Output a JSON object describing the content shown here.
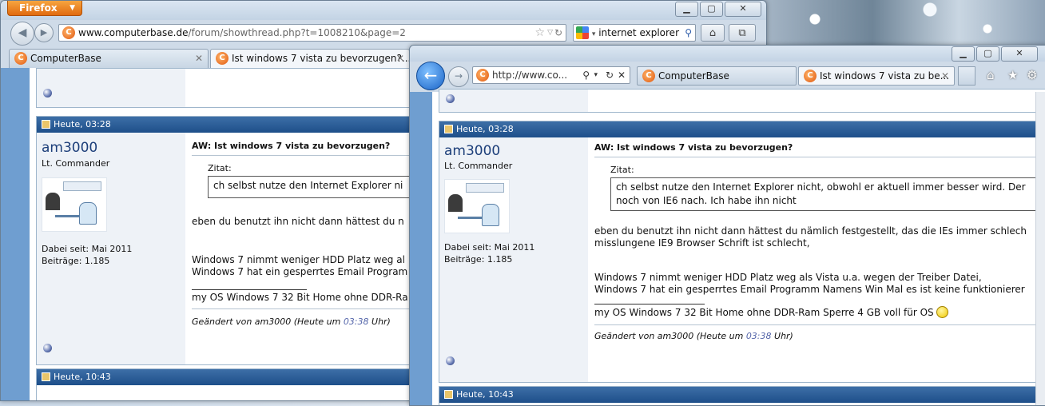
{
  "firefox": {
    "menu_button": "Firefox",
    "url_host": "www.computerbase.de",
    "url_path": "/forum/showthread.php?t=1008210&page=2",
    "search_text": "internet explorer",
    "tabs": [
      {
        "label": "ComputerBase"
      },
      {
        "label": "Ist windows 7 vista zu bevorzugen?..."
      }
    ],
    "post1": {
      "header": "Heute, 03:28",
      "username": "am3000",
      "rank": "Lt. Commander",
      "joined": "Dabei seit: Mai 2011",
      "posts": "Beiträge: 1.185",
      "title": "AW: Ist windows 7 vista zu bevorzugen?",
      "quote_label": "Zitat:",
      "quote_text": "ch selbst nutze den Internet Explorer ni",
      "line1": "eben du benutzt ihn nicht dann hättest du n",
      "line2": "Windows 7 nimmt weniger HDD Platz weg al",
      "line3": "Windows 7 hat ein gesperrtes Email Program",
      "signature": "my OS Windows 7 32 Bit Home ohne DDR-Ra",
      "edited_prefix": "Geändert von am3000 (Heute um ",
      "edited_time": "03:38",
      "edited_suffix": " Uhr)"
    },
    "post2": {
      "header": "Heute, 10:43"
    }
  },
  "ie": {
    "url_text": "http://www.co...",
    "tabs": [
      {
        "label": "ComputerBase"
      },
      {
        "label": "Ist windows 7 vista zu be..."
      }
    ],
    "post1": {
      "header": "Heute, 03:28",
      "username": "am3000",
      "rank": "Lt. Commander",
      "joined": "Dabei seit: Mai 2011",
      "posts": "Beiträge: 1.185",
      "title": "AW: Ist windows 7 vista zu bevorzugen?",
      "quote_label": "Zitat:",
      "quote_line1": "ch selbst nutze den Internet Explorer nicht, obwohl er aktuell immer besser wird. Der",
      "quote_line2": "noch von IE6 nach. Ich habe ihn nicht",
      "line1": "eben du benutzt ihn nicht dann hättest du nämlich festgestellt, das die IEs immer schlech",
      "line2": "misslungene IE9 Browser Schrift ist schlecht,",
      "line3": "Windows 7 nimmt weniger HDD Platz weg als Vista u.a. wegen der Treiber Datei,",
      "line4": "Windows 7 hat ein gesperrtes Email Programm Namens Win Mal es ist keine funktionierer",
      "signature": "my OS Windows 7 32 Bit Home ohne DDR-Ram Sperre 4 GB voll für OS",
      "edited_prefix": "Geändert von am3000 (Heute um ",
      "edited_time": "03:38",
      "edited_suffix": " Uhr)"
    },
    "post2": {
      "header": "Heute, 10:43"
    }
  },
  "icons": [
    "back-icon",
    "forward-icon",
    "bookmark-star-icon",
    "reload-icon",
    "google-icon",
    "search-icon",
    "home-icon",
    "addon-icon",
    "favorites-icon",
    "tools-gear-icon",
    "stop-icon"
  ]
}
